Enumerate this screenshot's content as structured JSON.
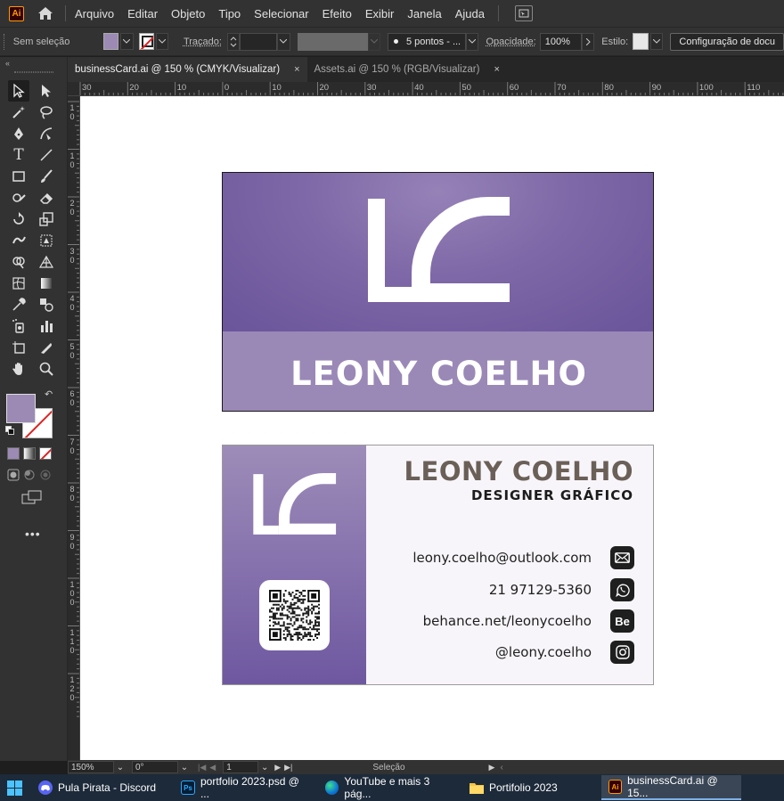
{
  "app": {
    "logo_text": "Ai",
    "menu": [
      "Arquivo",
      "Editar",
      "Objeto",
      "Tipo",
      "Selecionar",
      "Efeito",
      "Exibir",
      "Janela",
      "Ajuda"
    ]
  },
  "control_bar": {
    "selection_label": "Sem seleção",
    "stroke_label": "Traçado:",
    "brush_label": "5 pontos - ...",
    "opacity_label": "Opacidade:",
    "opacity_value": "100%",
    "style_label": "Estilo:",
    "doc_settings_label": "Configuração de docu",
    "fill_color": "#9c8ab5"
  },
  "tabs": [
    {
      "label": "businessCard.ai @ 150 % (CMYK/Visualizar)",
      "close": "×",
      "active": true
    },
    {
      "label": "Assets.ai @ 150 % (RGB/Visualizar)",
      "close": "×",
      "active": false
    }
  ],
  "ruler": {
    "h_labels": [
      "30",
      "20",
      "10",
      "0",
      "10",
      "20",
      "30",
      "40",
      "50",
      "60",
      "70",
      "80",
      "90",
      "100",
      "110"
    ],
    "v_labels": [
      "1 0",
      "1 0",
      "2 0",
      "3 0",
      "4 0",
      "5 0",
      "6 0",
      "7 0",
      "8 0",
      "9 0",
      "1 0 0",
      "1 1 0",
      "1 2 0"
    ]
  },
  "card_front": {
    "name": "LEONY COELHO",
    "bg_color": "#7e68a7",
    "band_color": "#9a88b7"
  },
  "card_back": {
    "name": "LEONY COELHO",
    "title": "DESIGNER GRÁFICO",
    "name_color": "#6b6058",
    "contacts": [
      {
        "text": "leony.coelho@outlook.com",
        "icon": "mail-icon"
      },
      {
        "text": "21 97129-5360",
        "icon": "whatsapp-icon"
      },
      {
        "text": "behance.net/leonycoelho",
        "icon": "behance-icon",
        "icon_text": "Be"
      },
      {
        "text": "@leony.coelho",
        "icon": "instagram-icon"
      }
    ]
  },
  "status_bar": {
    "zoom": "150%",
    "rotation": "0°",
    "artboard": "1",
    "tool": "Seleção"
  },
  "taskbar": {
    "items": [
      {
        "label": "Pula Pirata - Discord",
        "icon": "discord-icon"
      },
      {
        "label": "portfolio 2023.psd @ ...",
        "icon": "photoshop-icon",
        "icon_text": "Ps"
      },
      {
        "label": "YouTube e mais 3 pág...",
        "icon": "edge-icon"
      },
      {
        "label": "Portifolio 2023",
        "icon": "folder-icon"
      },
      {
        "label": "businessCard.ai @ 15...",
        "icon": "illustrator-icon",
        "icon_text": "Ai"
      }
    ]
  }
}
